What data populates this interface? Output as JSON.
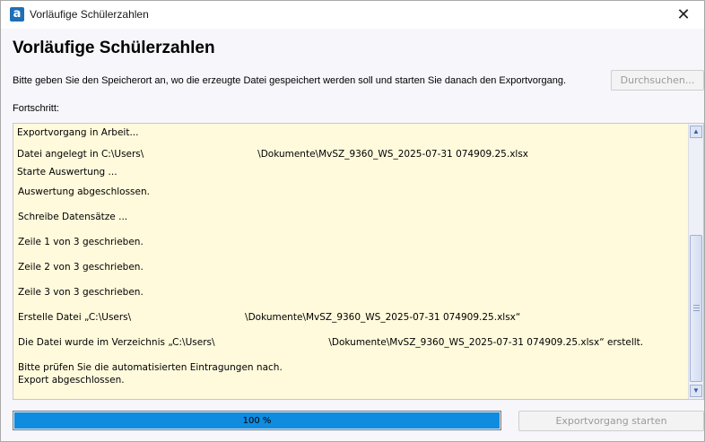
{
  "window": {
    "title": "Vorläufige Schülerzahlen",
    "app_icon_letter": "a",
    "close_glyph": "✕"
  },
  "dialog": {
    "heading": "Vorläufige Schülerzahlen",
    "instruction": "Bitte geben Sie den Speicherort an, wo die erzeugte Datei gespeichert werden soll und starten Sie danach den Exportvorgang.",
    "browse_label": "Durchsuchen...",
    "progress_label": "Fortschritt:",
    "start_label": "Exportvorgang starten"
  },
  "log": {
    "lines": [
      "Exportvorgang in Arbeit...",
      "Datei angelegt in C:\\Users\\                                      \\Dokumente\\MvSZ_9360_WS_2025-07-31 074909.25.xlsx",
      "Starte Auswertung ...",
      "Auswertung abgeschlossen.",
      "Schreibe Datensätze ...",
      "Zeile 1 von 3 geschrieben.",
      "Zeile 2 von 3 geschrieben.",
      "Zeile 3 von 3 geschrieben.",
      "Erstelle Datei „C:\\Users\\                                      \\Dokumente\\MvSZ_9360_WS_2025-07-31 074909.25.xlsx“",
      "Die Datei wurde im Verzeichnis „C:\\Users\\                                      \\Dokumente\\MvSZ_9360_WS_2025-07-31 074909.25.xlsx“ erstellt.",
      "Bitte prüfen Sie die automatisierten Eintragungen nach.",
      "Export abgeschlossen."
    ]
  },
  "progress": {
    "value": 100,
    "text": "100 %"
  },
  "colors": {
    "progress_fill": "#0f8ce0",
    "log_background": "#fffadc",
    "accent": "#1e6fb8"
  },
  "icons": {
    "app": "app-logo-icon",
    "close": "close-icon",
    "scroll_up": "scroll-up-arrow-icon",
    "scroll_down": "scroll-down-arrow-icon"
  }
}
